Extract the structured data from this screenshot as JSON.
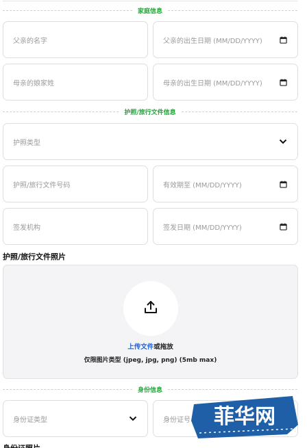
{
  "sections": {
    "family": "家庭信息",
    "passport": "护照/旅行文件信息",
    "identity": "身份信息"
  },
  "family": {
    "father_name": "父亲的名字",
    "father_dob": "父亲的出生日期 (MM/DD/YYYY)",
    "mother_maiden": "母亲的娘家姓",
    "mother_dob": "母亲的出生日期 (MM/DD/YYYY)"
  },
  "passport": {
    "type": "护照类型",
    "number": "护照/旅行文件号码",
    "expiry": "有效期至 (MM/DD/YYYY)",
    "authority": "签发机构",
    "issue_date": "签发日期 (MM/DD/YYYY)"
  },
  "passport_photo": {
    "title": "护照/旅行文件照片",
    "upload_link": "上传文件",
    "upload_rest": "或拖放",
    "hint": "仅限图片类型 (jpeg, jpg, png) (5mb max)"
  },
  "identity": {
    "id_type": "身份证类型",
    "id_number": "身份证号",
    "photo_title": "身份证照片"
  },
  "watermark": {
    "text": "菲华网"
  },
  "colors": {
    "section_green": "#22a83a",
    "link_blue": "#1e62d8",
    "watermark_blue": "#1f5fa8"
  }
}
